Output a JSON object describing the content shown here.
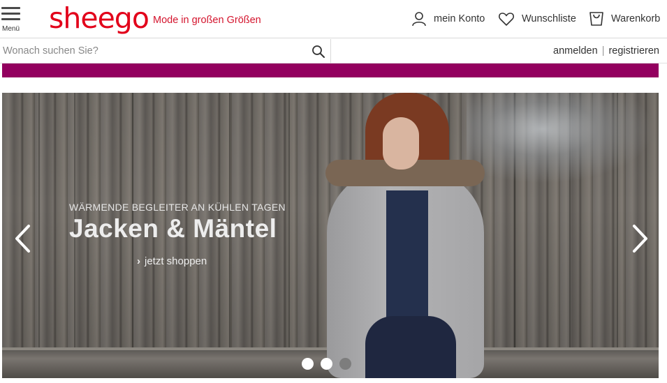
{
  "header": {
    "menu_label": "Menü",
    "logo_text": "sheego",
    "tagline": "Mode in großen Größen",
    "account_label": "mein Konto",
    "wishlist_label": "Wunschliste",
    "cart_label": "Warenkorb"
  },
  "search": {
    "placeholder": "Wonach suchen Sie?",
    "value": ""
  },
  "auth": {
    "login_label": "anmelden",
    "separator": "|",
    "register_label": "registrieren"
  },
  "hero": {
    "subtitle": "WÄRMENDE BEGLEITER AN KÜHLEN TAGEN",
    "title": "Jacken & Mäntel",
    "cta_label": "jetzt shoppen",
    "cta_chevron": "›",
    "slide_count": 3,
    "active_slide": 1
  },
  "colors": {
    "brand_red": "#e2001a",
    "promo_bar": "#93005f"
  },
  "icons": {
    "menu": "hamburger-icon",
    "account": "user-icon",
    "wishlist": "heart-icon",
    "cart": "shopping-bag-icon",
    "search": "search-icon",
    "prev": "chevron-left-icon",
    "next": "chevron-right-icon"
  }
}
